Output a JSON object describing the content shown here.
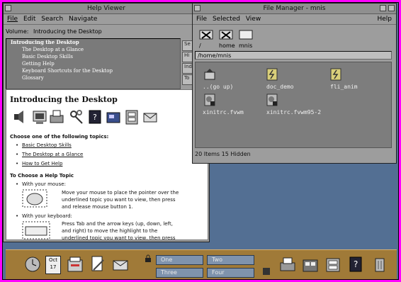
{
  "colors": {
    "background_frame": "#ff00ff",
    "desktop": "#536f93",
    "window": "#9d9d9d",
    "panel": "#a07a38",
    "workspace_button": "#7f93ad"
  },
  "help_viewer": {
    "title": "Help Viewer",
    "menus": [
      "File",
      "Edit",
      "Search",
      "Navigate"
    ],
    "volume_label": "Volume:",
    "volume_value": "Introducing the Desktop",
    "toc": [
      "Introducing the Desktop",
      "The Desktop at a Glance",
      "Basic Desktop Skills",
      "Getting Help",
      "Keyboard Shortcuts for the Desktop",
      "Glossary"
    ],
    "side_buttons": [
      "Se",
      "Hi",
      "Ind",
      "To"
    ],
    "content": {
      "heading": "Introducing the Desktop",
      "choose_label": "Choose one of the following topics:",
      "topics": [
        "Basic Desktop Skills",
        "The Desktop at a Glance",
        "How to Get Help"
      ],
      "help_topic_heading": "To Choose a Help Topic",
      "mouse_label": "With your mouse:",
      "mouse_text": "Move your mouse to place the pointer over the underlined topic you want to view, then press and release mouse button 1.",
      "keyboard_label": "With your keyboard:",
      "keyboard_text": "Press Tab and the arrow keys (up, down, left, and right) to move the highlight to the underlined topic you want to view, then press Return."
    }
  },
  "file_manager": {
    "title": "File Manager - mnis",
    "menus": [
      "File",
      "Selected",
      "View"
    ],
    "help_menu": "Help",
    "crumbs": [
      "/",
      "home",
      "mnis"
    ],
    "path": "/home/mnis",
    "files": [
      {
        "name": "..(go up)",
        "icon": "folder-up-icon"
      },
      {
        "name": "doc_demo",
        "icon": "executable-icon"
      },
      {
        "name": "fli_anim",
        "icon": "executable-icon"
      },
      {
        "name": "xinitrc.fvwm",
        "icon": "data-file-icon"
      },
      {
        "name": "xinitrc.fvwm95-2",
        "icon": "data-file-icon"
      }
    ],
    "status": "20 Items 15 Hidden"
  },
  "panel": {
    "date_month": "Oct",
    "date_day": "17",
    "workspaces": [
      "One",
      "Two",
      "Three",
      "Four"
    ]
  }
}
